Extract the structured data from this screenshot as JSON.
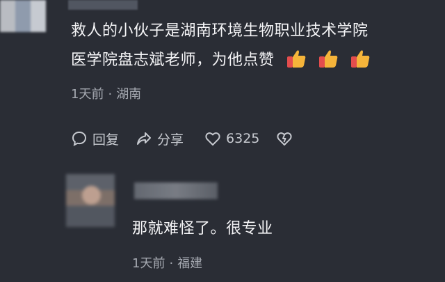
{
  "comment": {
    "line1": "救人的小伙子是湖南环境生物职业技术学院",
    "line2": "医学院盘志斌老师，为他点赞",
    "emoji_count": 3,
    "time": "1天前",
    "separator": "·",
    "location": "湖南",
    "actions": {
      "reply_label": "回复",
      "share_label": "分享",
      "like_count": "6325"
    }
  },
  "reply": {
    "text": "那就难怪了。很专业",
    "time": "1天前",
    "separator": "·",
    "location": "福建"
  },
  "colors": {
    "background": "#2a2d35",
    "primary_text": "#f4f4f6",
    "secondary_text": "#a5a9b1",
    "icon": "#c7cad0",
    "thumb": "#f5b43a",
    "thumb_cuff": "#e44d4d"
  },
  "icons": [
    "thumbs-up-icon",
    "comment-bubble-icon",
    "share-arrow-icon",
    "heart-icon",
    "dislike-heart-icon"
  ]
}
